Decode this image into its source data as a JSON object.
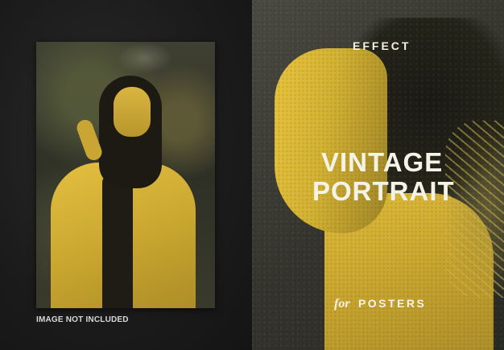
{
  "left": {
    "disclaimer": "IMAGE NOT INCLUDED"
  },
  "right": {
    "effect_label": "EFFECT",
    "title_line1": "VINTAGE",
    "title_line2": "PORTRAIT",
    "subtitle_for": "for",
    "subtitle_word": "POSTERS"
  },
  "colors": {
    "accent_yellow": "#d9b53a",
    "background": "#161616",
    "text": "#f5f2e6"
  }
}
